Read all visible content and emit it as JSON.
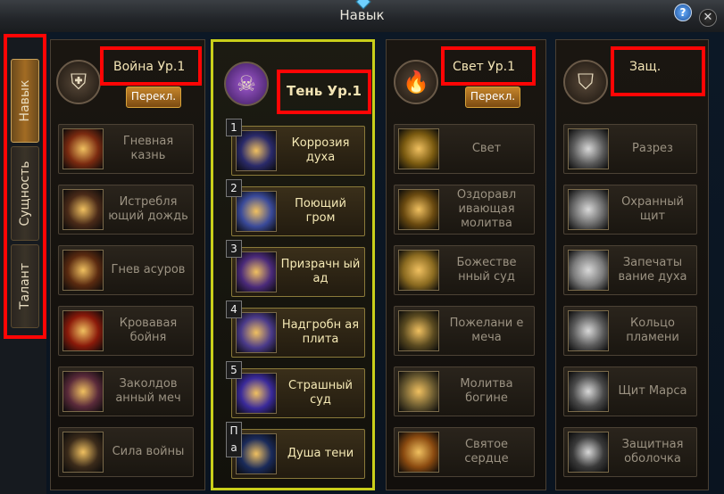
{
  "window": {
    "title": "Навык"
  },
  "tabs": [
    {
      "label": "Навык",
      "active": true
    },
    {
      "label": "Сущность",
      "active": false
    },
    {
      "label": "Талант",
      "active": false
    }
  ],
  "columns": [
    {
      "name": "Война",
      "level": "Ур.1",
      "switch_label": "Перекл.",
      "selected": false,
      "icon": "helmet-icon",
      "skills": [
        "Гневная казнь",
        "Истребля ющий дождь",
        "Гнев асуров",
        "Кровавая бойня",
        "Заколдов анный меч",
        "Сила войны"
      ]
    },
    {
      "name": "Тень",
      "level": "Ур.1",
      "switch_label": "",
      "selected": true,
      "icon": "skull-icon",
      "skills": [
        "Коррозия духа",
        "Поющий гром",
        "Призрачн ый ад",
        "Надгробн ая плита",
        "Страшный суд",
        "Душа тени"
      ],
      "slot_numbers": [
        "1",
        "2",
        "3",
        "4",
        "5",
        "П а"
      ]
    },
    {
      "name": "Свет",
      "level": "Ур.1",
      "switch_label": "Перекл.",
      "selected": false,
      "icon": "flame-icon",
      "skills": [
        "Свет",
        "Оздоравл ивающая молитва",
        "Божестве нный суд",
        "Пожелани е меча",
        "Молитва богине",
        "Святое сердце"
      ]
    },
    {
      "name": "Защ.",
      "level": "",
      "switch_label": "",
      "selected": false,
      "icon": "shield-icon",
      "skills": [
        "Разрез",
        "Охранный щит",
        "Запечаты вание духа",
        "Кольцо пламени",
        "Щит Марса",
        "Защитная оболочка"
      ]
    }
  ],
  "colors": {
    "accent": "#c9cf1a",
    "highlight": "#ff0505",
    "button": "#c5852a"
  }
}
